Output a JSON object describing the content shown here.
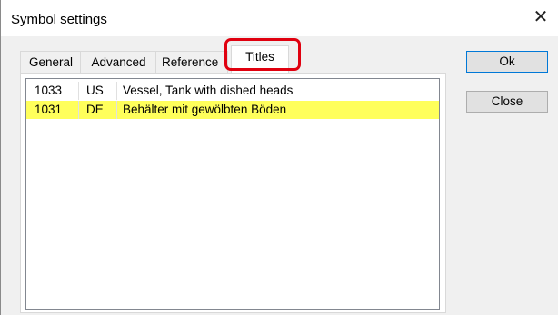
{
  "window": {
    "title": "Symbol settings",
    "close_glyph": "✕"
  },
  "tabs": [
    {
      "label": "General"
    },
    {
      "label": "Advanced"
    },
    {
      "label": "Reference"
    },
    {
      "label": "Titles",
      "active": true
    }
  ],
  "titles_list": {
    "rows": [
      {
        "id": "1033",
        "lang": "US",
        "title": "Vessel, Tank with dished heads"
      },
      {
        "id": "1031",
        "lang": "DE",
        "title": "Behälter mit gewölbten Böden",
        "selected": true
      }
    ]
  },
  "buttons": {
    "ok": "Ok",
    "close": "Close"
  },
  "colors": {
    "selection": "#ffff5b",
    "annotation": "#e0000f"
  }
}
